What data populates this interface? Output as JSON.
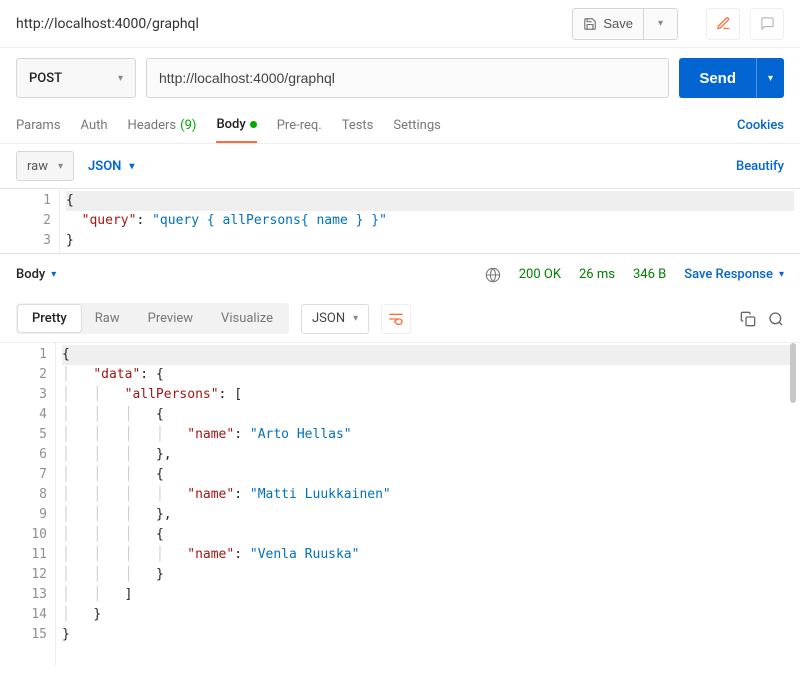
{
  "header": {
    "title": "http://localhost:4000/graphql",
    "save_label": "Save"
  },
  "request": {
    "method": "POST",
    "url": "http://localhost:4000/graphql",
    "send_label": "Send"
  },
  "tabs": {
    "params": "Params",
    "auth": "Auth",
    "headers": "Headers",
    "headers_count": "(9)",
    "body": "Body",
    "prereq": "Pre-req.",
    "tests": "Tests",
    "settings": "Settings",
    "cookies": "Cookies"
  },
  "body_controls": {
    "raw": "raw",
    "format": "JSON",
    "beautify": "Beautify"
  },
  "request_body_lines": [
    "{",
    "  \"query\": \"query { allPersons{ name } }\"",
    "}"
  ],
  "response": {
    "section_label": "Body",
    "status_code": "200",
    "status_text": "OK",
    "time": "26 ms",
    "size": "346 B",
    "save_label": "Save Response"
  },
  "resp_tabs": {
    "pretty": "Pretty",
    "raw": "Raw",
    "preview": "Preview",
    "visualize": "Visualize",
    "format": "JSON"
  },
  "response_body": {
    "data": {
      "allPersons": [
        {
          "name": "Arto Hellas"
        },
        {
          "name": "Matti Luukkainen"
        },
        {
          "name": "Venla Ruuska"
        }
      ]
    }
  },
  "response_body_lines": [
    "{",
    "    \"data\": {",
    "        \"allPersons\": [",
    "            {",
    "                \"name\": \"Arto Hellas\"",
    "            },",
    "            {",
    "                \"name\": \"Matti Luukkainen\"",
    "            },",
    "            {",
    "                \"name\": \"Venla Ruuska\"",
    "            }",
    "        ]",
    "    }",
    "}"
  ]
}
